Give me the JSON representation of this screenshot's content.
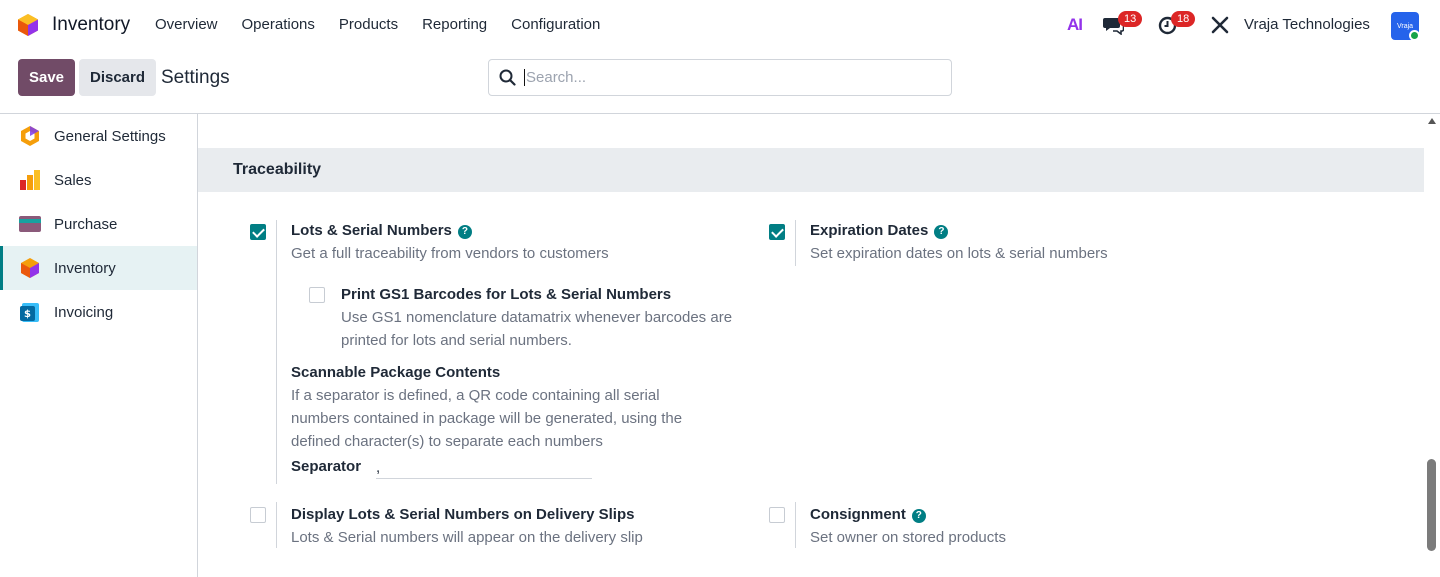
{
  "navbar": {
    "app_name": "Inventory",
    "menu": [
      "Overview",
      "Operations",
      "Products",
      "Reporting",
      "Configuration"
    ],
    "ai_label": "AI",
    "messages_count": "13",
    "activities_count": "18",
    "company": "Vraja Technologies",
    "avatar_text": "Vraja"
  },
  "control": {
    "save_label": "Save",
    "discard_label": "Discard",
    "title": "Settings",
    "search_placeholder": "Search..."
  },
  "sidebar": {
    "items": [
      {
        "label": "General Settings",
        "icon": "odoo-icon"
      },
      {
        "label": "Sales",
        "icon": "sales-chart-icon"
      },
      {
        "label": "Purchase",
        "icon": "purchase-card-icon"
      },
      {
        "label": "Inventory",
        "icon": "inventory-box-icon",
        "active": true
      },
      {
        "label": "Invoicing",
        "icon": "invoicing-icon"
      }
    ]
  },
  "section": {
    "title": "Traceability",
    "lots": {
      "title": "Lots & Serial Numbers",
      "desc": "Get a full traceability from vendors to customers",
      "checked": true
    },
    "gs1": {
      "title": "Print GS1 Barcodes for Lots & Serial Numbers",
      "desc": "Use GS1 nomenclature datamatrix whenever barcodes are printed for lots and serial numbers.",
      "checked": false
    },
    "scannable": {
      "title": "Scannable Package Contents",
      "desc": "If a separator is defined, a QR code containing all serial numbers contained in package will be generated, using the defined character(s) to separate each numbers",
      "separator_label": "Separator",
      "separator_value": ","
    },
    "expiration": {
      "title": "Expiration Dates",
      "desc": "Set expiration dates on lots & serial numbers",
      "checked": true
    },
    "delivery": {
      "title": "Display Lots & Serial Numbers on Delivery Slips",
      "desc": "Lots & Serial numbers will appear on the delivery slip",
      "checked": false
    },
    "consignment": {
      "title": "Consignment",
      "desc": "Set owner on stored products",
      "checked": false
    },
    "help_glyph": "?"
  },
  "colors": {
    "brand": "#714b67",
    "accent": "#017e84",
    "badge": "#dc2626"
  }
}
